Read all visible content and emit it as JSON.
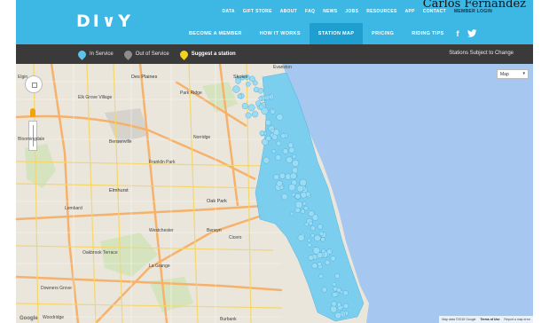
{
  "author": "Carlos Fernandez",
  "header": {
    "logo": "DI∨Y",
    "util_nav": [
      "DATA",
      "GIFT STORE",
      "ABOUT",
      "FAQ",
      "NEWS",
      "JOBS",
      "RESOURCES",
      "APP",
      "CONTACT"
    ],
    "member_login": "MEMBER LOGIN",
    "main_nav": [
      {
        "label": "BECOME A MEMBER",
        "active": false
      },
      {
        "label": "HOW IT WORKS",
        "active": false
      },
      {
        "label": "STATION MAP",
        "active": true
      },
      {
        "label": "PRICING",
        "active": false
      },
      {
        "label": "RIDING TIPS",
        "active": false
      }
    ],
    "social": {
      "facebook": "f",
      "twitter": "❛"
    },
    "colors": {
      "accent": "#3db7e4",
      "active": "#1e9fcf"
    }
  },
  "statusbar": {
    "in_service": "In Service",
    "out_of_service": "Out of Service",
    "suggest": "Suggest a station",
    "notice": "Stations Subject to Change"
  },
  "map": {
    "map_type": "Map",
    "labels": [
      {
        "text": "Des Plaines",
        "kind": "city"
      },
      {
        "text": "Park Ridge",
        "kind": "label"
      },
      {
        "text": "Skokie",
        "kind": "city"
      },
      {
        "text": "Evanston",
        "kind": "label"
      },
      {
        "text": "Elk Grove Village",
        "kind": "label"
      },
      {
        "text": "Bensenville",
        "kind": "label"
      },
      {
        "text": "Norridge",
        "kind": "label"
      },
      {
        "text": "Franklin Park",
        "kind": "label"
      },
      {
        "text": "Elmhurst",
        "kind": "city"
      },
      {
        "text": "Lombard",
        "kind": "label"
      },
      {
        "text": "Oak Park",
        "kind": "city"
      },
      {
        "text": "Westchester",
        "kind": "label"
      },
      {
        "text": "Berwyn",
        "kind": "label"
      },
      {
        "text": "Cicero",
        "kind": "label"
      },
      {
        "text": "Oakbrook Terrace",
        "kind": "label"
      },
      {
        "text": "Downers Grove",
        "kind": "label"
      },
      {
        "text": "La Grange",
        "kind": "label"
      },
      {
        "text": "Woodridge",
        "kind": "label"
      },
      {
        "text": "Burbank",
        "kind": "label"
      },
      {
        "text": "Bloomingdale",
        "kind": "label"
      },
      {
        "text": "Elgin",
        "kind": "label"
      }
    ],
    "attribution": {
      "data": "Map data ©2015 Google",
      "terms": "Terms of Use",
      "report": "Report a map error"
    },
    "colors": {
      "water": "#a6c8f0",
      "land": "#eae6dc",
      "stations": "#76cdef"
    }
  }
}
